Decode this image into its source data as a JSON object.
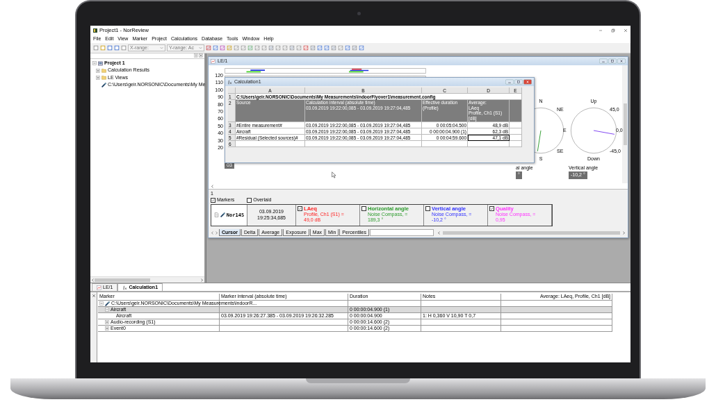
{
  "window": {
    "title": "Project1 - NorReview"
  },
  "menu": [
    "File",
    "Edit",
    "View",
    "Marker",
    "Project",
    "Calculations",
    "Database",
    "Tools",
    "Window",
    "Help"
  ],
  "toolbar": {
    "x_range": "X-range:",
    "y_range": "Y-range: Ac"
  },
  "project_tree": [
    {
      "label": "Project 1",
      "kind": "project",
      "expanded": true,
      "children": [
        {
          "label": "Calculation Results",
          "kind": "folder",
          "expanded": false
        },
        {
          "label": "LE Views",
          "kind": "folder",
          "expanded": false
        },
        {
          "label": "C:\\Users\\geir.NORSONIC\\Documents\\My Me",
          "kind": "file"
        }
      ]
    }
  ],
  "le_window": {
    "title": "LE/1",
    "chart": {
      "y_ticks": [
        "120",
        "110",
        "100",
        "90",
        "80",
        "70",
        "60",
        "50",
        "40",
        "30",
        "20"
      ],
      "cursor_box": "03"
    },
    "compasses": [
      {
        "labels": [
          "N",
          "NE",
          "E",
          "SE",
          "S"
        ],
        "caption": "al angle",
        "value": "°",
        "kind": "horizontal"
      },
      {
        "labels": [
          "Up",
          "45,0",
          "0,0",
          "-45,0",
          "Down"
        ],
        "caption": "Vertical angle",
        "value": "-10,2 °",
        "kind": "vertical"
      }
    ],
    "cursor_panel": {
      "index": "1",
      "options": [
        {
          "label": "Markers",
          "checked": true
        },
        {
          "label": "Overlaid",
          "checked": false
        }
      ],
      "instrument": "Nor145",
      "time": "03.09.2019\n19:25:34,685",
      "channels": [
        {
          "title": "LAeq",
          "source": "Profile, Ch1 (S1) =",
          "value": "49,0 dB",
          "color": "#ff2020",
          "checked": true
        },
        {
          "title": "Horizontal angle",
          "source": "Noise Compass,  =",
          "value": "189,3 °",
          "color": "#2a9a2a",
          "checked": false
        },
        {
          "title": "Vertical angle",
          "source": "Noise Compass,  =",
          "value": "-10,2 °",
          "color": "#3030ff",
          "checked": false
        },
        {
          "title": "Quality",
          "source": "Noise Compass,  =",
          "value": "0,95",
          "color": "#ff30ff",
          "checked": true
        }
      ]
    },
    "tabs": [
      {
        "label": "Cursor",
        "selected": true
      },
      {
        "label": "Delta",
        "selected": false
      },
      {
        "label": "Average",
        "selected": false
      },
      {
        "label": "Exposure",
        "selected": false
      },
      {
        "label": "Max",
        "selected": false
      },
      {
        "label": "Min",
        "selected": false
      },
      {
        "label": "Percentiles",
        "selected": false
      }
    ]
  },
  "calc_window": {
    "title": "Calculation1",
    "columns": [
      "A",
      "B",
      "C",
      "D",
      "E"
    ],
    "rows": [
      {
        "n": "1",
        "kind": "path",
        "text": "C:\\Users\\geir.NORSONIC\\Documents\\My Measurements\\indoorFlyover1\\measurement.config"
      },
      {
        "n": "2",
        "kind": "header",
        "cells": [
          "Source",
          "Calculation interval (absolute time)\n03.09.2019 19:22:00,085 - 03.09.2019 19:27:04,485",
          "Effective duration\n(Profile)",
          "Average:\nLAeq\nProfile, Ch1 (S1)\n[dB]"
        ]
      },
      {
        "n": "3",
        "kind": "data",
        "selected": false,
        "cells": [
          "#Entire measurement#",
          "03.09.2019 19:22:00,085 - 03.09.2019 19:27:04,485",
          "0 00:05:04.500",
          "48,9 dB"
        ]
      },
      {
        "n": "4",
        "kind": "data",
        "selected": false,
        "cells": [
          "Aircraft",
          "03.09.2019 19:22:00,085 - 03.09.2019 19:27:04,485",
          "0 00:00:04.900 (1)",
          "62,3 dB"
        ]
      },
      {
        "n": "5",
        "kind": "data",
        "selected": true,
        "cells": [
          "#Residual (Selected sources)#",
          "03.09.2019 19:22:00,085 - 03.09.2019 19:27:04,485",
          "0 00:04:59.600",
          "47,1 dB"
        ]
      },
      {
        "n": "6",
        "kind": "empty"
      }
    ]
  },
  "window_tabs": [
    {
      "label": "LE/1",
      "kind": "chart",
      "selected": false
    },
    {
      "label": "Calculation1",
      "kind": "calc",
      "selected": true
    }
  ],
  "marker_table": {
    "columns": [
      "Marker",
      "Marker interval (absolute time)",
      "Duration",
      "Notes",
      "Average: LAeq, Profile, Ch1 [dB]"
    ],
    "rows": [
      {
        "marker": "C:\\Users\\geir.NORSONIC\\Documents\\My Measurements\\indoorR...",
        "kind": "file",
        "expanded": true,
        "selected": false,
        "children": [
          {
            "marker": "Aircraft",
            "duration": "0 00:00:04.900 (1)",
            "expanded": true,
            "selected": true,
            "children": [
              {
                "marker": "Aircraft",
                "interval": "03.09.2019 19:26:27.385 - 03.09.2019 19:26:32.285",
                "duration": "0 00:00:04.900",
                "notes": "1: H 0,360 V 10,90 T 0,7",
                "selected": false
              }
            ]
          },
          {
            "marker": "Audio-recording (S1)",
            "duration": "0 00:00:14.600 (2)",
            "expanded": false,
            "selected": false
          },
          {
            "marker": "Event0",
            "duration": "0 00:00:14.600 (2)",
            "expanded": false,
            "selected": false
          }
        ]
      }
    ]
  }
}
